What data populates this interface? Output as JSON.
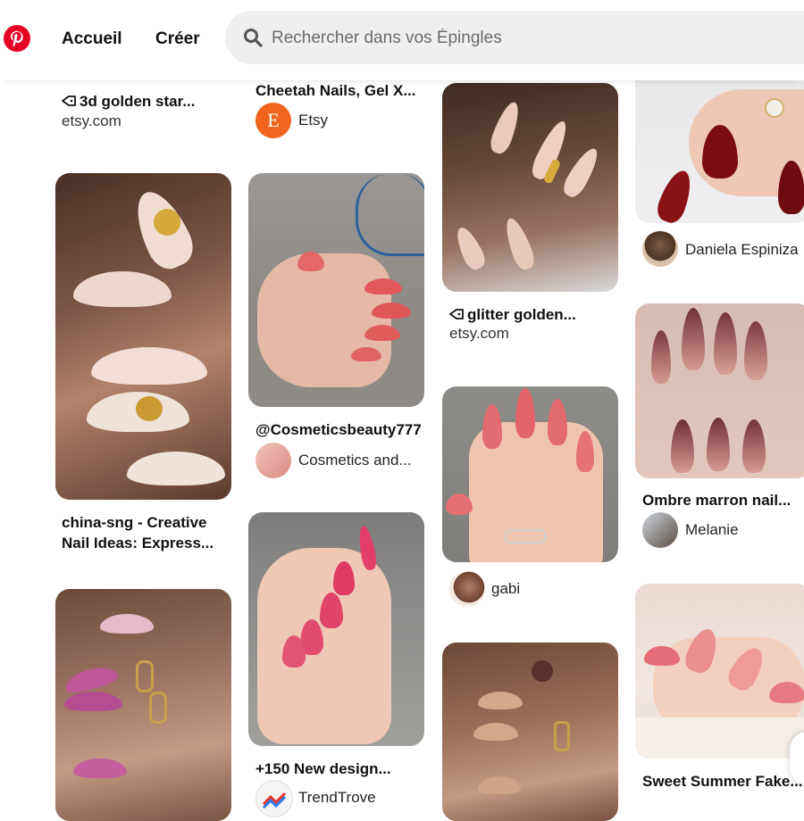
{
  "header": {
    "logo_icon": "pinterest-logo-icon",
    "brand_color": "#e60023",
    "nav": {
      "home": "Accueil",
      "create": "Créer"
    },
    "search": {
      "placeholder": "Rechercher dans vos Épingles",
      "value": ""
    }
  },
  "pins": {
    "col1": [
      {
        "title": "3d golden star...",
        "source": "etsy.com",
        "has_tag": true
      },
      {
        "title_line1": "china-sng - Creative",
        "title_line2": "Nail Ideas: Express..."
      },
      {
        "image_only": true
      }
    ],
    "col2": [
      {
        "title": "Cheetah Nails, Gel X...",
        "author": "Etsy",
        "avatar_letter": "E"
      },
      {
        "title": "@Cosmeticsbeauty777",
        "author": "Cosmetics and..."
      },
      {
        "title": "+150 New design...",
        "author": "TrendTrove"
      }
    ],
    "col3": [
      {
        "title": "glitter golden...",
        "source": "etsy.com",
        "has_tag": true
      },
      {
        "author": "gabi"
      },
      {
        "image_only": true
      }
    ],
    "col4": [
      {
        "author": "Daniela Espiniza"
      },
      {
        "title": "Ombre marron nail...",
        "author": "Melanie"
      },
      {
        "title": "Sweet Summer Fake..."
      }
    ]
  },
  "colors": {
    "accent": "#e60023",
    "search_bg": "#efefef",
    "etsy_orange": "#f1641e"
  }
}
